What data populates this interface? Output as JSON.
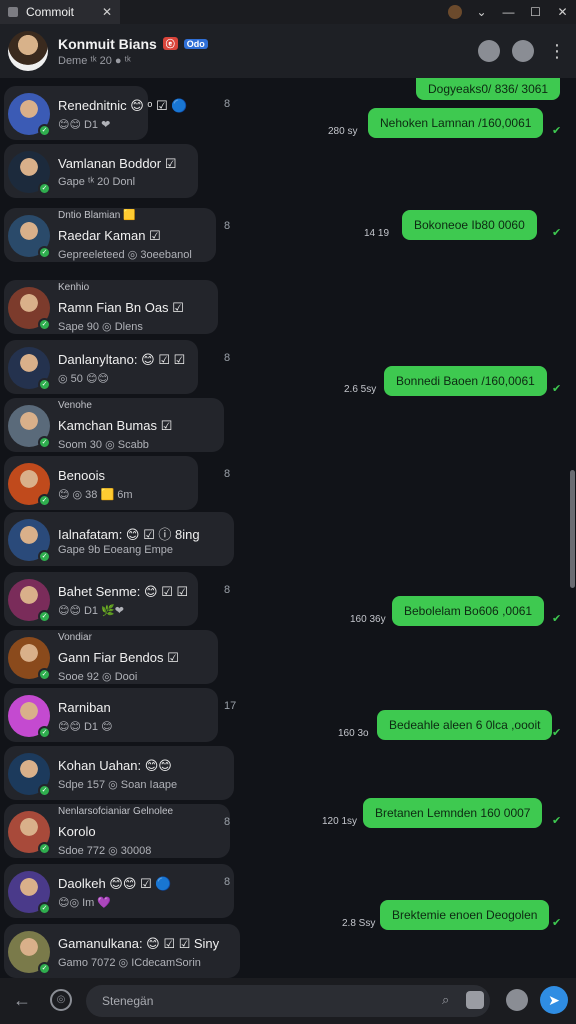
{
  "window": {
    "tab_title": "Commoit",
    "tab_close": "✕",
    "controls": {
      "chevron": "⌄",
      "minimize": "—",
      "maximize": "☐",
      "close": "✕"
    }
  },
  "header": {
    "name": "Konmuit Bians",
    "badge_red": "ⓔ",
    "badge_blue": "Odo",
    "status": "Deme ᵗᵏ 20 ● ᵗᵏ",
    "icons": [
      "profile-icon",
      "search-icon",
      "more-icon"
    ]
  },
  "chats": [
    {
      "small": "",
      "name": "Renednitnic 😊 ᵒ ☑ 🔵",
      "sub": "😊😊 D1 ❤",
      "count": "8",
      "avatar_color": "#3b5bb5"
    },
    {
      "small": "",
      "name": "Vamlanan Boddor ☑",
      "sub": "Gape ᵗᵏ 20 Donl",
      "count": "",
      "avatar_color": "#1c2a3c"
    },
    {
      "small": "Dntio Blamian 🟨",
      "name": "Raedar Kaman ☑",
      "sub": "Gepreeleteed ◎ 3oeebanol",
      "count": "8",
      "avatar_color": "#2a4a6a"
    },
    {
      "small": "Kenhio",
      "name": "Ramn Fian Bn Oas ☑",
      "sub": "Sape 90 ◎ Dlens",
      "count": "",
      "avatar_color": "#7c3b2c"
    },
    {
      "small": "",
      "name": "Danlanyltano: 😊 ☑ ☑",
      "sub": "◎ 50 😊😊",
      "count": "8",
      "avatar_color": "#24324e"
    },
    {
      "small": "Venohe",
      "name": "Kamchan Bumas ☑",
      "sub": "Soom 30 ◎ Scabb",
      "count": "",
      "avatar_color": "#5a6a7a"
    },
    {
      "small": "",
      "name": "Benoois",
      "sub": "😊 ◎ 38 🟨 6m",
      "count": "8",
      "avatar_color": "#c04a1c"
    },
    {
      "small": "",
      "name": "Ialnafatam: 😊 ☑ ⓘ 8ing",
      "sub": "Gape 9b Eoeang Empe",
      "count": "",
      "avatar_color": "#2a4a7a"
    },
    {
      "small": "",
      "name": "Bahet Senme: 😊 ☑ ☑",
      "sub": "😊😊 D1 🌿❤",
      "count": "8",
      "avatar_color": "#7a2c5a"
    },
    {
      "small": "Vondiar",
      "name": "Gann Fiar Bendos ☑",
      "sub": "Sooe 92 ◎ Dooi",
      "count": "",
      "avatar_color": "#8a4a1c"
    },
    {
      "small": "",
      "name": "Rarniban",
      "sub": "😊😊 D1 😊",
      "count": "17",
      "avatar_color": "#c44ad0"
    },
    {
      "small": "",
      "name": "Kohan Uahan: 😊😊",
      "sub": "Sdpe 157 ◎ Soan Iaape",
      "count": "",
      "avatar_color": "#1c3a5c"
    },
    {
      "small": "Nenlarsofcianiar Gelnolee",
      "name": "Korolo",
      "sub": "Sdoe 772 ◎ 30008",
      "count": "8",
      "avatar_color": "#a84a3a"
    },
    {
      "small": "",
      "name": "Daolkeh 😊😊 ☑ 🔵",
      "sub": "😊◎ Im 💜",
      "count": "8",
      "avatar_color": "#4a3a8a"
    },
    {
      "small": "",
      "name": "Gamanulkana: 😊 ☑ ☑ Siny",
      "sub": "Gamo 7072 ◎ ICdecamSorin",
      "count": "",
      "avatar_color": "#7a7a4a"
    }
  ],
  "messages": [
    {
      "text": "Dogyeaks0/ 836/ 3061",
      "time": "",
      "tick": ""
    },
    {
      "text": "Nehoken Lamnan /160,0061",
      "time": "280 sy",
      "tick": "✔"
    },
    {
      "text": "Bokoneoe Ib80 0060",
      "time": "14 19",
      "tick": "✔"
    },
    {
      "text": "Bonnedi Baoen /160,0061",
      "time": "2.6 5sy",
      "tick": "✔"
    },
    {
      "text": "Bebolelam Bo606 ,0061",
      "time": "160 36y",
      "tick": "✔"
    },
    {
      "text": "Bedeahle aleen 6 0lca ,oooit",
      "time": "160 3o",
      "tick": "✔"
    },
    {
      "text": "Bretanen Lemnden 160 0007",
      "time": "120 1sy",
      "tick": "✔"
    },
    {
      "text": "Brektemie enoen Deogolen",
      "time": "2.8 Ssy",
      "tick": "✔"
    }
  ],
  "composer": {
    "placeholder": "Stenegän",
    "back": "←",
    "attach": "◎",
    "search": "🔍",
    "send": "➤"
  }
}
